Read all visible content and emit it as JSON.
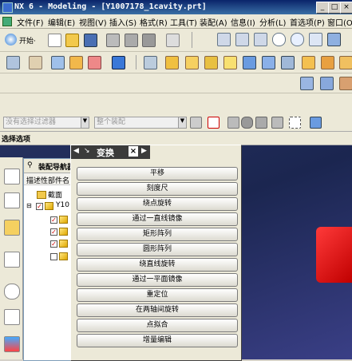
{
  "window": {
    "title": "NX 6 - Modeling - [Y1007178_1cavity.prt]",
    "controls": [
      "_",
      "□",
      "×"
    ]
  },
  "menu": [
    "文件(F)",
    "编辑(E)",
    "视图(V)",
    "插入(S)",
    "格式(R)",
    "工具(T)",
    "装配(A)",
    "信息(I)",
    "分析(L)",
    "首选项(P)",
    "窗口(O)"
  ],
  "toolbar": {
    "start_label": "开始·"
  },
  "selection": {
    "filter_placeholder": "没有选择过滤器",
    "scope_placeholder": "整个装配",
    "bar_label": "选择选项"
  },
  "navigator": {
    "title": "装配导航器",
    "column": "描述性部件名",
    "items": [
      "截面",
      "Y10"
    ]
  },
  "dialog": {
    "title": "变换",
    "options": [
      "平移",
      "刻度尺",
      "绕点旋转",
      "通过一直线镜像",
      "矩形阵列",
      "圆形阵列",
      "绕直线旋转",
      "通过一平面镜像",
      "重定位",
      "在两轴间旋转",
      "点拟合",
      "增量编辑"
    ]
  },
  "colors": {
    "title_bar": "#0a246a",
    "graphics_bg": "#1b2650",
    "part_red": "#e00000"
  }
}
